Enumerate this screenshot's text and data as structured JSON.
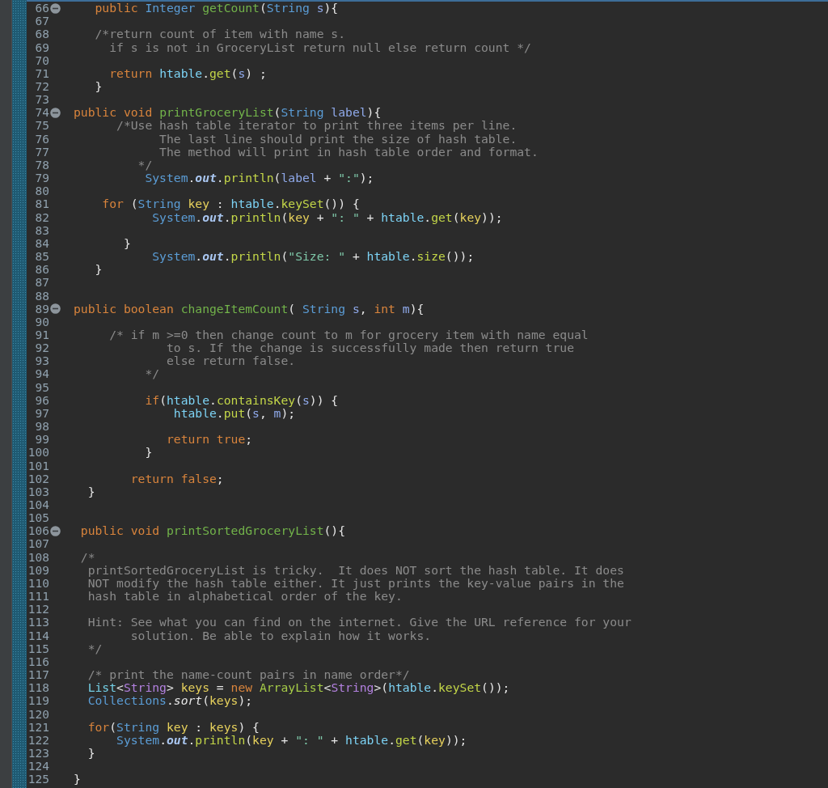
{
  "editor": {
    "lines": [
      {
        "number": "66",
        "foldable": true,
        "tokens": [
          {
            "text": "   public ",
            "kind": "keyword"
          },
          {
            "text": "Integer ",
            "kind": "type"
          },
          {
            "text": "getCount",
            "kind": "declaration"
          },
          {
            "text": "(",
            "kind": "plain"
          },
          {
            "text": "String ",
            "kind": "type"
          },
          {
            "text": "s",
            "kind": "parameter"
          },
          {
            "text": "){",
            "kind": "plain"
          }
        ]
      },
      {
        "number": "67",
        "foldable": false
      },
      {
        "number": "68",
        "foldable": false,
        "tokens": [
          {
            "text": "   /*return count of item with name s.",
            "kind": "comment"
          }
        ]
      },
      {
        "number": "69",
        "foldable": false,
        "tokens": [
          {
            "text": "     if s is not in GroceryList return null else return count */",
            "kind": "comment"
          }
        ]
      },
      {
        "number": "70",
        "foldable": false
      },
      {
        "number": "71",
        "foldable": false,
        "tokens": [
          {
            "text": "     return ",
            "kind": "keyword"
          },
          {
            "text": "htable",
            "kind": "field"
          },
          {
            "text": ".",
            "kind": "plain"
          },
          {
            "text": "get",
            "kind": "call"
          },
          {
            "text": "(",
            "kind": "plain"
          },
          {
            "text": "s",
            "kind": "parameter"
          },
          {
            "text": ") ;",
            "kind": "plain"
          }
        ]
      },
      {
        "number": "72",
        "foldable": false,
        "tokens": [
          {
            "text": "   }",
            "kind": "plain"
          }
        ]
      },
      {
        "number": "73",
        "foldable": false
      },
      {
        "number": "74",
        "foldable": true,
        "tokens": [
          {
            "text": "public void ",
            "kind": "keyword"
          },
          {
            "text": "printGroceryList",
            "kind": "declaration"
          },
          {
            "text": "(",
            "kind": "plain"
          },
          {
            "text": "String ",
            "kind": "type"
          },
          {
            "text": "label",
            "kind": "parameter"
          },
          {
            "text": "){",
            "kind": "plain"
          }
        ]
      },
      {
        "number": "75",
        "foldable": false,
        "tokens": [
          {
            "text": "      /*Use hash table iterator to print three items per line.",
            "kind": "comment"
          }
        ]
      },
      {
        "number": "76",
        "foldable": false,
        "tokens": [
          {
            "text": "            The last line should print the size of hash table.",
            "kind": "comment"
          }
        ]
      },
      {
        "number": "77",
        "foldable": false,
        "tokens": [
          {
            "text": "            The method will print in hash table order and format.",
            "kind": "comment"
          }
        ]
      },
      {
        "number": "78",
        "foldable": false,
        "tokens": [
          {
            "text": "         */",
            "kind": "comment"
          }
        ]
      },
      {
        "number": "79",
        "foldable": false,
        "tokens": [
          {
            "text": "          System",
            "kind": "type"
          },
          {
            "text": ".",
            "kind": "plain"
          },
          {
            "text": "out",
            "kind": "static"
          },
          {
            "text": ".",
            "kind": "plain"
          },
          {
            "text": "println",
            "kind": "call"
          },
          {
            "text": "(",
            "kind": "plain"
          },
          {
            "text": "label",
            "kind": "parameter"
          },
          {
            "text": " + ",
            "kind": "plain"
          },
          {
            "text": "\":\"",
            "kind": "string"
          },
          {
            "text": ");",
            "kind": "plain"
          }
        ]
      },
      {
        "number": "80",
        "foldable": false
      },
      {
        "number": "81",
        "foldable": false,
        "tokens": [
          {
            "text": "    for",
            "kind": "keyword"
          },
          {
            "text": " (",
            "kind": "plain"
          },
          {
            "text": "String ",
            "kind": "type"
          },
          {
            "text": "key",
            "kind": "local"
          },
          {
            "text": " : ",
            "kind": "plain"
          },
          {
            "text": "htable",
            "kind": "field"
          },
          {
            "text": ".",
            "kind": "plain"
          },
          {
            "text": "keySet",
            "kind": "call"
          },
          {
            "text": "()) {",
            "kind": "plain"
          }
        ]
      },
      {
        "number": "82",
        "foldable": false,
        "tokens": [
          {
            "text": "           System",
            "kind": "type"
          },
          {
            "text": ".",
            "kind": "plain"
          },
          {
            "text": "out",
            "kind": "static"
          },
          {
            "text": ".",
            "kind": "plain"
          },
          {
            "text": "println",
            "kind": "call"
          },
          {
            "text": "(",
            "kind": "plain"
          },
          {
            "text": "key",
            "kind": "local"
          },
          {
            "text": " + ",
            "kind": "plain"
          },
          {
            "text": "\": \"",
            "kind": "string"
          },
          {
            "text": " + ",
            "kind": "plain"
          },
          {
            "text": "htable",
            "kind": "field"
          },
          {
            "text": ".",
            "kind": "plain"
          },
          {
            "text": "get",
            "kind": "call"
          },
          {
            "text": "(",
            "kind": "plain"
          },
          {
            "text": "key",
            "kind": "local"
          },
          {
            "text": "));",
            "kind": "plain"
          }
        ]
      },
      {
        "number": "83",
        "foldable": false
      },
      {
        "number": "84",
        "foldable": false,
        "tokens": [
          {
            "text": "       }",
            "kind": "plain"
          }
        ]
      },
      {
        "number": "85",
        "foldable": false,
        "tokens": [
          {
            "text": "           System",
            "kind": "type"
          },
          {
            "text": ".",
            "kind": "plain"
          },
          {
            "text": "out",
            "kind": "static"
          },
          {
            "text": ".",
            "kind": "plain"
          },
          {
            "text": "println",
            "kind": "call"
          },
          {
            "text": "(",
            "kind": "plain"
          },
          {
            "text": "\"Size: \"",
            "kind": "string"
          },
          {
            "text": " + ",
            "kind": "plain"
          },
          {
            "text": "htable",
            "kind": "field"
          },
          {
            "text": ".",
            "kind": "plain"
          },
          {
            "text": "size",
            "kind": "call"
          },
          {
            "text": "());",
            "kind": "plain"
          }
        ]
      },
      {
        "number": "86",
        "foldable": false,
        "tokens": [
          {
            "text": "   }",
            "kind": "plain"
          }
        ]
      },
      {
        "number": "87",
        "foldable": false
      },
      {
        "number": "88",
        "foldable": false
      },
      {
        "number": "89",
        "foldable": true,
        "tokens": [
          {
            "text": "public boolean ",
            "kind": "keyword"
          },
          {
            "text": "changeItemCount",
            "kind": "declaration"
          },
          {
            "text": "( ",
            "kind": "plain"
          },
          {
            "text": "String ",
            "kind": "type"
          },
          {
            "text": "s",
            "kind": "parameter"
          },
          {
            "text": ", ",
            "kind": "plain"
          },
          {
            "text": "int ",
            "kind": "keyword"
          },
          {
            "text": "m",
            "kind": "parameter"
          },
          {
            "text": "){",
            "kind": "plain"
          }
        ]
      },
      {
        "number": "90",
        "foldable": false
      },
      {
        "number": "91",
        "foldable": false,
        "tokens": [
          {
            "text": "     /* if m >=0 then change count to m for grocery item with name equal",
            "kind": "comment"
          }
        ]
      },
      {
        "number": "92",
        "foldable": false,
        "tokens": [
          {
            "text": "             to s. If the change is successfully made then return true",
            "kind": "comment"
          }
        ]
      },
      {
        "number": "93",
        "foldable": false,
        "tokens": [
          {
            "text": "             else return false.",
            "kind": "comment"
          }
        ]
      },
      {
        "number": "94",
        "foldable": false,
        "tokens": [
          {
            "text": "          */",
            "kind": "comment"
          }
        ]
      },
      {
        "number": "95",
        "foldable": false
      },
      {
        "number": "96",
        "foldable": false,
        "tokens": [
          {
            "text": "          if",
            "kind": "keyword"
          },
          {
            "text": "(",
            "kind": "plain"
          },
          {
            "text": "htable",
            "kind": "field"
          },
          {
            "text": ".",
            "kind": "plain"
          },
          {
            "text": "containsKey",
            "kind": "call"
          },
          {
            "text": "(",
            "kind": "plain"
          },
          {
            "text": "s",
            "kind": "parameter"
          },
          {
            "text": ")) {",
            "kind": "plain"
          }
        ]
      },
      {
        "number": "97",
        "foldable": false,
        "tokens": [
          {
            "text": "              htable",
            "kind": "field"
          },
          {
            "text": ".",
            "kind": "plain"
          },
          {
            "text": "put",
            "kind": "call"
          },
          {
            "text": "(",
            "kind": "plain"
          },
          {
            "text": "s",
            "kind": "parameter"
          },
          {
            "text": ", ",
            "kind": "plain"
          },
          {
            "text": "m",
            "kind": "parameter"
          },
          {
            "text": ");",
            "kind": "plain"
          }
        ]
      },
      {
        "number": "98",
        "foldable": false
      },
      {
        "number": "99",
        "foldable": false,
        "tokens": [
          {
            "text": "             return true",
            "kind": "keyword"
          },
          {
            "text": ";",
            "kind": "plain"
          }
        ]
      },
      {
        "number": "100",
        "foldable": false,
        "tokens": [
          {
            "text": "          }",
            "kind": "plain"
          }
        ]
      },
      {
        "number": "101",
        "foldable": false
      },
      {
        "number": "102",
        "foldable": false,
        "tokens": [
          {
            "text": "        return false",
            "kind": "keyword"
          },
          {
            "text": ";",
            "kind": "plain"
          }
        ]
      },
      {
        "number": "103",
        "foldable": false,
        "tokens": [
          {
            "text": "  }",
            "kind": "plain"
          }
        ]
      },
      {
        "number": "104",
        "foldable": false
      },
      {
        "number": "105",
        "foldable": false
      },
      {
        "number": "106",
        "foldable": true,
        "tokens": [
          {
            "text": " public void ",
            "kind": "keyword"
          },
          {
            "text": "printSortedGroceryList",
            "kind": "declaration"
          },
          {
            "text": "(){",
            "kind": "plain"
          }
        ]
      },
      {
        "number": "107",
        "foldable": false
      },
      {
        "number": "108",
        "foldable": false,
        "tokens": [
          {
            "text": " /*",
            "kind": "comment"
          }
        ]
      },
      {
        "number": "109",
        "foldable": false,
        "tokens": [
          {
            "text": "  printSortedGroceryList is tricky.  It does NOT sort the hash table. It does",
            "kind": "comment"
          }
        ]
      },
      {
        "number": "110",
        "foldable": false,
        "tokens": [
          {
            "text": "  NOT modify the hash table either. It just prints the key-value pairs in the",
            "kind": "comment"
          }
        ]
      },
      {
        "number": "111",
        "foldable": false,
        "tokens": [
          {
            "text": "  hash table in alphabetical order of the key.",
            "kind": "comment"
          }
        ]
      },
      {
        "number": "112",
        "foldable": false
      },
      {
        "number": "113",
        "foldable": false,
        "tokens": [
          {
            "text": "  Hint: See what you can find on the internet. Give the URL reference for your",
            "kind": "comment"
          }
        ]
      },
      {
        "number": "114",
        "foldable": false,
        "tokens": [
          {
            "text": "        solution. Be able to explain how it works.",
            "kind": "comment"
          }
        ]
      },
      {
        "number": "115",
        "foldable": false,
        "tokens": [
          {
            "text": "  */",
            "kind": "comment"
          }
        ]
      },
      {
        "number": "116",
        "foldable": false
      },
      {
        "number": "117",
        "foldable": false,
        "tokens": [
          {
            "text": "  /* print the name-count pairs in name order*/",
            "kind": "comment"
          }
        ]
      },
      {
        "number": "118",
        "foldable": false,
        "tokens": [
          {
            "text": "  List",
            "kind": "interface"
          },
          {
            "text": "<",
            "kind": "plain"
          },
          {
            "text": "String",
            "kind": "typearg"
          },
          {
            "text": "> ",
            "kind": "plain"
          },
          {
            "text": "keys",
            "kind": "local"
          },
          {
            "text": " = ",
            "kind": "plain"
          },
          {
            "text": "new ",
            "kind": "keyword"
          },
          {
            "text": "ArrayList",
            "kind": "constructor"
          },
          {
            "text": "<",
            "kind": "plain"
          },
          {
            "text": "String",
            "kind": "typearg"
          },
          {
            "text": ">(",
            "kind": "plain"
          },
          {
            "text": "htable",
            "kind": "field"
          },
          {
            "text": ".",
            "kind": "plain"
          },
          {
            "text": "keySet",
            "kind": "call"
          },
          {
            "text": "());",
            "kind": "plain"
          }
        ]
      },
      {
        "number": "119",
        "foldable": false,
        "tokens": [
          {
            "text": "  Collections",
            "kind": "type"
          },
          {
            "text": ".",
            "kind": "plain"
          },
          {
            "text": "sort",
            "kind": "staticcall"
          },
          {
            "text": "(",
            "kind": "plain"
          },
          {
            "text": "keys",
            "kind": "local"
          },
          {
            "text": ");",
            "kind": "plain"
          }
        ]
      },
      {
        "number": "120",
        "foldable": false
      },
      {
        "number": "121",
        "foldable": false,
        "tokens": [
          {
            "text": "  for",
            "kind": "keyword"
          },
          {
            "text": "(",
            "kind": "plain"
          },
          {
            "text": "String ",
            "kind": "type"
          },
          {
            "text": "key",
            "kind": "local"
          },
          {
            "text": " : ",
            "kind": "plain"
          },
          {
            "text": "keys",
            "kind": "local"
          },
          {
            "text": ") {",
            "kind": "plain"
          }
        ]
      },
      {
        "number": "122",
        "foldable": false,
        "tokens": [
          {
            "text": "      System",
            "kind": "type"
          },
          {
            "text": ".",
            "kind": "plain"
          },
          {
            "text": "out",
            "kind": "static"
          },
          {
            "text": ".",
            "kind": "plain"
          },
          {
            "text": "println",
            "kind": "call"
          },
          {
            "text": "(",
            "kind": "plain"
          },
          {
            "text": "key",
            "kind": "local"
          },
          {
            "text": " + ",
            "kind": "plain"
          },
          {
            "text": "\": \"",
            "kind": "string"
          },
          {
            "text": " + ",
            "kind": "plain"
          },
          {
            "text": "htable",
            "kind": "field"
          },
          {
            "text": ".",
            "kind": "plain"
          },
          {
            "text": "get",
            "kind": "call"
          },
          {
            "text": "(",
            "kind": "plain"
          },
          {
            "text": "key",
            "kind": "local"
          },
          {
            "text": "));",
            "kind": "plain"
          }
        ]
      },
      {
        "number": "123",
        "foldable": false,
        "tokens": [
          {
            "text": "  }",
            "kind": "plain"
          }
        ]
      },
      {
        "number": "124",
        "foldable": false
      },
      {
        "number": "125",
        "foldable": false,
        "tokens": [
          {
            "text": "}",
            "kind": "plain"
          }
        ]
      }
    ]
  }
}
